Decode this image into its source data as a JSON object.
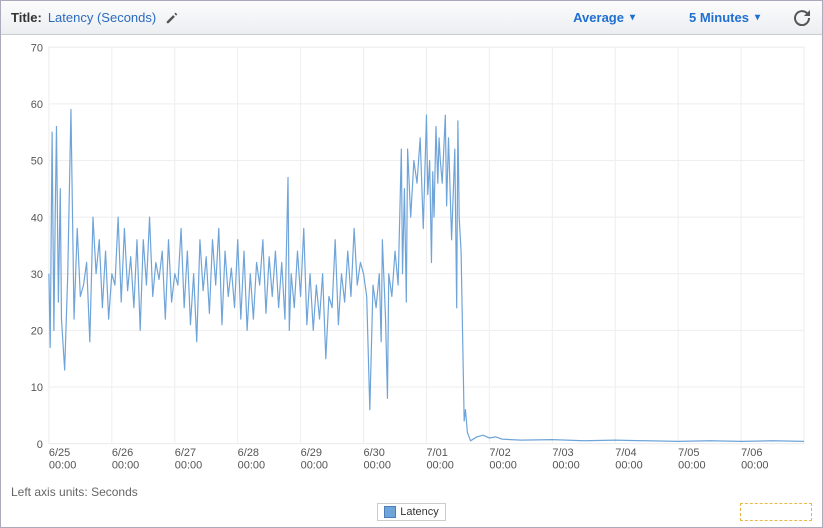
{
  "header": {
    "title_label": "Title:",
    "title_value": "Latency (Seconds)",
    "edit_icon": "pencil-icon",
    "aggregation_label": "Average",
    "period_label": "5 Minutes",
    "refresh_icon": "refresh-icon"
  },
  "axis_units_label": "Left axis units:",
  "axis_units_value": "Seconds",
  "legend_label": "Latency",
  "chart_data": {
    "type": "line",
    "title": "Latency (Seconds)",
    "xlabel": "",
    "ylabel": "",
    "ylim": [
      0,
      70
    ],
    "y_ticks": [
      0,
      10,
      20,
      30,
      40,
      50,
      60,
      70
    ],
    "x_ticks": [
      {
        "major": "6/25",
        "minor": "00:00"
      },
      {
        "major": "6/26",
        "minor": "00:00"
      },
      {
        "major": "6/27",
        "minor": "00:00"
      },
      {
        "major": "6/28",
        "minor": "00:00"
      },
      {
        "major": "6/29",
        "minor": "00:00"
      },
      {
        "major": "6/30",
        "minor": "00:00"
      },
      {
        "major": "7/01",
        "minor": "00:00"
      },
      {
        "major": "7/02",
        "minor": "00:00"
      },
      {
        "major": "7/03",
        "minor": "00:00"
      },
      {
        "major": "7/04",
        "minor": "00:00"
      },
      {
        "major": "7/05",
        "minor": "00:00"
      },
      {
        "major": "7/06",
        "minor": "00:00"
      }
    ],
    "x_range": [
      0,
      12
    ],
    "series": [
      {
        "name": "Latency",
        "color": "#6fa4d9",
        "x": [
          0.0,
          0.02,
          0.05,
          0.08,
          0.1,
          0.12,
          0.15,
          0.18,
          0.2,
          0.25,
          0.3,
          0.35,
          0.4,
          0.45,
          0.5,
          0.55,
          0.6,
          0.65,
          0.7,
          0.75,
          0.8,
          0.85,
          0.9,
          0.95,
          1.0,
          1.05,
          1.1,
          1.15,
          1.2,
          1.25,
          1.3,
          1.35,
          1.4,
          1.45,
          1.5,
          1.55,
          1.6,
          1.65,
          1.7,
          1.75,
          1.8,
          1.85,
          1.9,
          1.95,
          2.0,
          2.05,
          2.1,
          2.15,
          2.2,
          2.25,
          2.3,
          2.35,
          2.4,
          2.45,
          2.5,
          2.55,
          2.6,
          2.65,
          2.7,
          2.75,
          2.8,
          2.85,
          2.9,
          2.95,
          3.0,
          3.05,
          3.1,
          3.15,
          3.2,
          3.25,
          3.3,
          3.35,
          3.4,
          3.45,
          3.5,
          3.55,
          3.6,
          3.65,
          3.7,
          3.75,
          3.8,
          3.82,
          3.85,
          3.9,
          3.95,
          4.0,
          4.05,
          4.1,
          4.15,
          4.2,
          4.25,
          4.3,
          4.35,
          4.4,
          4.45,
          4.5,
          4.55,
          4.6,
          4.65,
          4.7,
          4.75,
          4.8,
          4.85,
          4.9,
          4.95,
          5.0,
          5.05,
          5.1,
          5.15,
          5.2,
          5.25,
          5.28,
          5.3,
          5.35,
          5.38,
          5.4,
          5.45,
          5.5,
          5.55,
          5.6,
          5.62,
          5.65,
          5.68,
          5.7,
          5.75,
          5.8,
          5.85,
          5.9,
          5.95,
          6.0,
          6.02,
          6.05,
          6.08,
          6.1,
          6.12,
          6.15,
          6.18,
          6.2,
          6.22,
          6.25,
          6.3,
          6.32,
          6.35,
          6.4,
          6.45,
          6.48,
          6.5,
          6.52,
          6.55,
          6.6,
          6.62,
          6.65,
          6.7,
          6.8,
          6.9,
          7.0,
          7.1,
          7.2,
          7.5,
          8.0,
          8.5,
          9.0,
          9.5,
          10.0,
          10.5,
          11.0,
          11.5,
          12.0
        ],
        "values": [
          30,
          17,
          55,
          20,
          40,
          56,
          25,
          45,
          22,
          13,
          30,
          59,
          22,
          38,
          26,
          28,
          32,
          18,
          40,
          30,
          36,
          24,
          34,
          22,
          30,
          28,
          40,
          25,
          38,
          27,
          33,
          24,
          36,
          20,
          36,
          28,
          40,
          26,
          32,
          29,
          34,
          22,
          36,
          25,
          30,
          28,
          38,
          24,
          34,
          21,
          30,
          18,
          36,
          27,
          33,
          23,
          36,
          28,
          38,
          21,
          34,
          26,
          31,
          24,
          36,
          22,
          34,
          20,
          30,
          22,
          32,
          28,
          36,
          23,
          33,
          26,
          34,
          24,
          32,
          22,
          47,
          20,
          30,
          24,
          34,
          26,
          38,
          21,
          30,
          20,
          28,
          22,
          30,
          15,
          26,
          24,
          36,
          21,
          30,
          25,
          34,
          26,
          38,
          28,
          32,
          30,
          26,
          6,
          28,
          24,
          30,
          18,
          36,
          22,
          8,
          30,
          26,
          34,
          28,
          52,
          30,
          45,
          25,
          52,
          40,
          50,
          46,
          54,
          38,
          58,
          44,
          50,
          32,
          48,
          40,
          56,
          46,
          54,
          50,
          46,
          58,
          42,
          54,
          36,
          52,
          24,
          57,
          40,
          34,
          4,
          6,
          2,
          0.5,
          1.2,
          1.5,
          1,
          1.2,
          0.8,
          0.6,
          0.7,
          0.5,
          0.6,
          0.5,
          0.4,
          0.5,
          0.4,
          0.5,
          0.4
        ]
      }
    ]
  }
}
